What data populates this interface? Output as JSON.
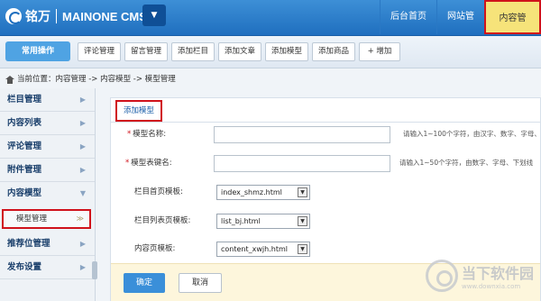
{
  "header": {
    "logo_cn": "铭万",
    "logo_en": "MAINONE CMS",
    "dropdown_glyph": "▼",
    "nav": [
      "后台首页",
      "网站管理",
      "内容管理"
    ]
  },
  "toolbar": {
    "main_label": "常用操作",
    "buttons": [
      "评论管理",
      "留言管理",
      "添加栏目",
      "添加文章",
      "添加模型",
      "添加商品",
      "+ 增加"
    ]
  },
  "breadcrumb": {
    "text": "当前位置：内容管理 -> 内容模型 -> 模型管理"
  },
  "sidebar": {
    "items": [
      "栏目管理",
      "内容列表",
      "评论管理",
      "附件管理",
      "内容模型",
      "推荐位管理",
      "发布设置"
    ],
    "sub_item": "模型管理",
    "arrow": "▶",
    "open_arrow": "▼",
    "sub_arrow": "≫"
  },
  "main": {
    "tab": "添加模型",
    "fields": {
      "name_label": "模型名称:",
      "name_hint": "请输入1~100个字符，由汉字、数字、字母、",
      "table_label": "模型表键名:",
      "table_hint": "请输入1~50个字符，由数字、字母、下划线",
      "index_label": "栏目首页模板:",
      "index_value": "index_shmz.html",
      "list_label": "栏目列表页模板:",
      "list_value": "list_bj.html",
      "content_label": "内容页模板:",
      "content_value": "content_xwjh.html",
      "required_mark": "*",
      "select_glyph": "▼"
    },
    "ok": "确定",
    "cancel": "取消"
  },
  "watermark": {
    "cn": "当下软件园",
    "en": "www.downxia.com"
  }
}
